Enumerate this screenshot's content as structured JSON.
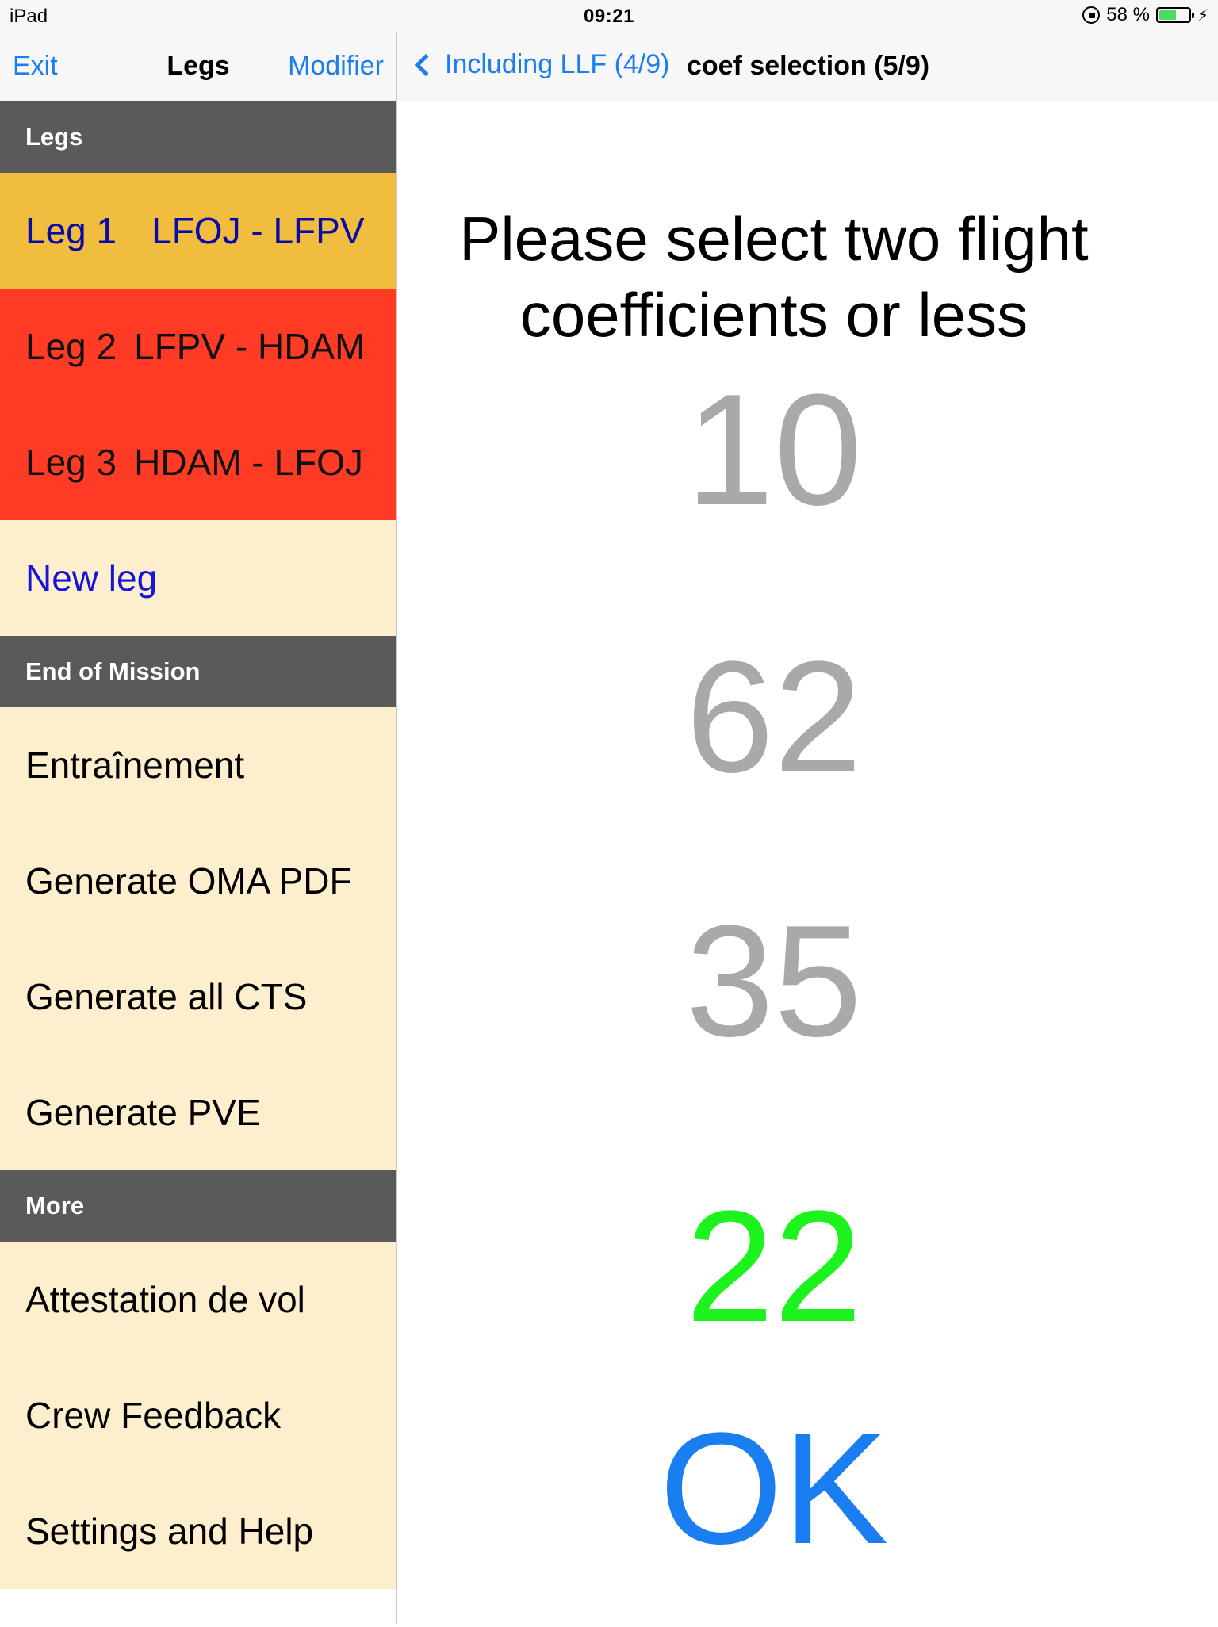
{
  "status_bar": {
    "device": "iPad",
    "time": "09:21",
    "battery_text": "58 %",
    "battery_level": 0.58
  },
  "left_nav": {
    "exit_label": "Exit",
    "title": "Legs",
    "modify_label": "Modifier"
  },
  "right_nav": {
    "back_label": "Including LLF (4/9)",
    "title": "coef selection (5/9)"
  },
  "sidebar": {
    "sections": [
      {
        "header": "Legs",
        "rows": [
          {
            "leg": "Leg 1",
            "route": "LFOJ - LFPV",
            "color": "#f0bd3e"
          },
          {
            "leg": "Leg 2",
            "route": "LFPV - HDAM",
            "color": "#ff3b26"
          },
          {
            "leg": "Leg 3",
            "route": "HDAM - LFOJ",
            "color": "#ff3b26"
          },
          {
            "label": "New leg"
          }
        ]
      },
      {
        "header": "End of Mission",
        "rows": [
          {
            "label": "Entraînement"
          },
          {
            "label": "Generate OMA PDF"
          },
          {
            "label": "Generate all CTS"
          },
          {
            "label": "Generate PVE"
          }
        ]
      },
      {
        "header": "More",
        "rows": [
          {
            "label": "Attestation de vol"
          },
          {
            "label": "Crew Feedback"
          },
          {
            "label": "Settings and Help"
          }
        ]
      }
    ]
  },
  "content": {
    "prompt_line1": "Please select two flight",
    "prompt_line2": "coefficients or less",
    "coefficients": [
      {
        "value": "10",
        "selected": false
      },
      {
        "value": "62",
        "selected": false
      },
      {
        "value": "35",
        "selected": false
      },
      {
        "value": "22",
        "selected": true
      }
    ],
    "ok_label": "OK"
  },
  "colors": {
    "accent": "#1a7ef0",
    "selected_coef": "#1cf31c",
    "unselected_coef": "#a9a9a9",
    "section_header": "#5a5a5a",
    "row_background": "#fdefcd"
  }
}
